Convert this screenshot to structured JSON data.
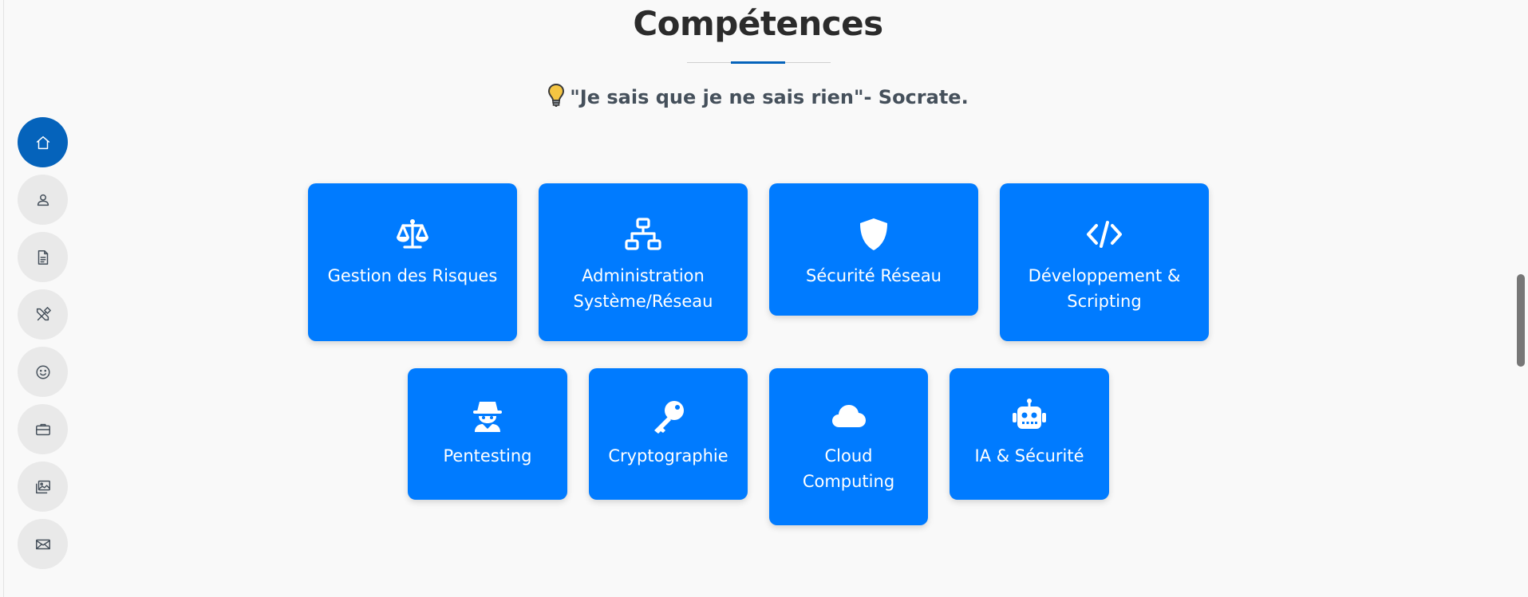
{
  "section": {
    "title": "Compétences",
    "quote": "\"Je sais que je ne sais rien\"- Socrate."
  },
  "sidebar": {
    "items": [
      {
        "name": "home",
        "icon": "home-icon",
        "active": true
      },
      {
        "name": "about",
        "icon": "person-icon",
        "active": false
      },
      {
        "name": "resume",
        "icon": "document-icon",
        "active": false
      },
      {
        "name": "skills",
        "icon": "tools-icon",
        "active": false
      },
      {
        "name": "interests",
        "icon": "smile-icon",
        "active": false
      },
      {
        "name": "portfolio",
        "icon": "briefcase-icon",
        "active": false
      },
      {
        "name": "gallery",
        "icon": "images-icon",
        "active": false
      },
      {
        "name": "contact",
        "icon": "envelope-icon",
        "active": false
      }
    ]
  },
  "skills": [
    {
      "label": "Gestion des Risques",
      "icon": "scale-icon"
    },
    {
      "label": "Administration Système/Réseau",
      "icon": "network-icon"
    },
    {
      "label": "Sécurité Réseau",
      "icon": "shield-icon"
    },
    {
      "label": "Développement & Scripting",
      "icon": "code-icon"
    },
    {
      "label": "Pentesting",
      "icon": "spy-icon"
    },
    {
      "label": "Cryptographie",
      "icon": "key-icon"
    },
    {
      "label": "Cloud Computing",
      "icon": "cloud-icon"
    },
    {
      "label": "IA & Sécurité",
      "icon": "robot-icon"
    }
  ],
  "colors": {
    "accent": "#0563bb",
    "card": "#007bff",
    "heading": "#2b2b2b",
    "text": "#45505b",
    "background": "#f9f9f9"
  }
}
